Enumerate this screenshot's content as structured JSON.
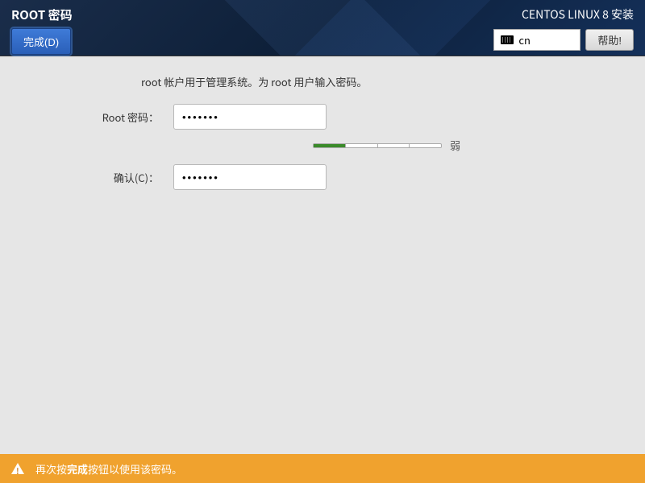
{
  "header": {
    "page_title": "ROOT 密码",
    "done_button": "完成(D)",
    "installer_title": "CENTOS LINUX 8 安装",
    "keyboard_layout": "cn",
    "help_button": "帮助!"
  },
  "form": {
    "instruction": "root 帐户用于管理系统。为 root 用户输入密码。",
    "password_label": "Root 密码：",
    "password_value": "•••••••",
    "confirm_label": "确认(C)：",
    "confirm_value": "•••••••",
    "strength_label": "弱",
    "strength_segments_filled": 1,
    "strength_segments_total": 4
  },
  "warning": {
    "prefix": "再次按",
    "bold": "完成",
    "suffix": "按钮以使用该密码。"
  }
}
